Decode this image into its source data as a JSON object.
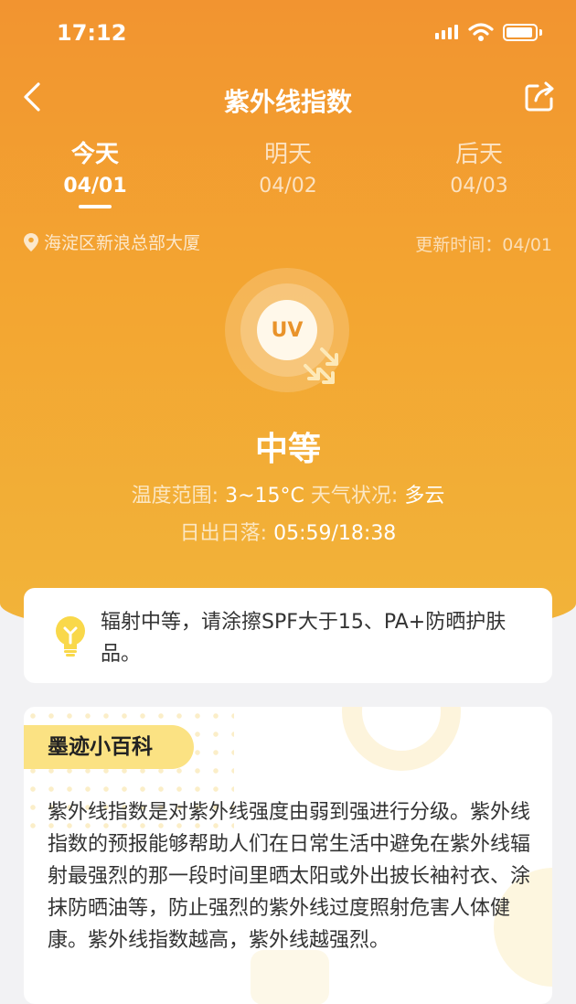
{
  "status_bar": {
    "time": "17:12",
    "icons": [
      "signal-icon",
      "wifi-icon",
      "battery-icon"
    ]
  },
  "nav": {
    "title": "紫外线指数",
    "back_icon": "back-chevron-icon",
    "share_icon": "share-icon"
  },
  "day_tabs": [
    {
      "name": "今天",
      "date": "04/01",
      "active": true
    },
    {
      "name": "明天",
      "date": "04/02",
      "active": false
    },
    {
      "name": "后天",
      "date": "04/03",
      "active": false
    }
  ],
  "location": {
    "icon": "location-pin-icon",
    "text": "海淀区新浪总部大厦"
  },
  "update_time": "更新时间：04/01",
  "uv": {
    "badge": "UV",
    "level": "中等",
    "temp_label": "温度范围:",
    "temp_value": "3~15°C",
    "weather_label": "天气状况:",
    "weather_value": "多云",
    "sun_label": "日出日落:",
    "sun_value": "05:59/18:38"
  },
  "tip": {
    "icon": "lightbulb-icon",
    "text": "辐射中等，请涂擦SPF大于15、PA+防晒护肤品。"
  },
  "wiki": {
    "title": "墨迹小百科",
    "body": "紫外线指数是对紫外线强度由弱到强进行分级。紫外线指数的预报能够帮助人们在日常生活中避免在紫外线辐射最强烈的那一段时间里晒太阳或外出披长袖衬衣、涂抹防晒油等，防止强烈的紫外线过度照射危害人体健康。紫外线指数越高，紫外线越强烈。"
  },
  "colors": {
    "accent": "#f29430",
    "badge": "#fbe283",
    "uv_text": "#e9932a"
  }
}
